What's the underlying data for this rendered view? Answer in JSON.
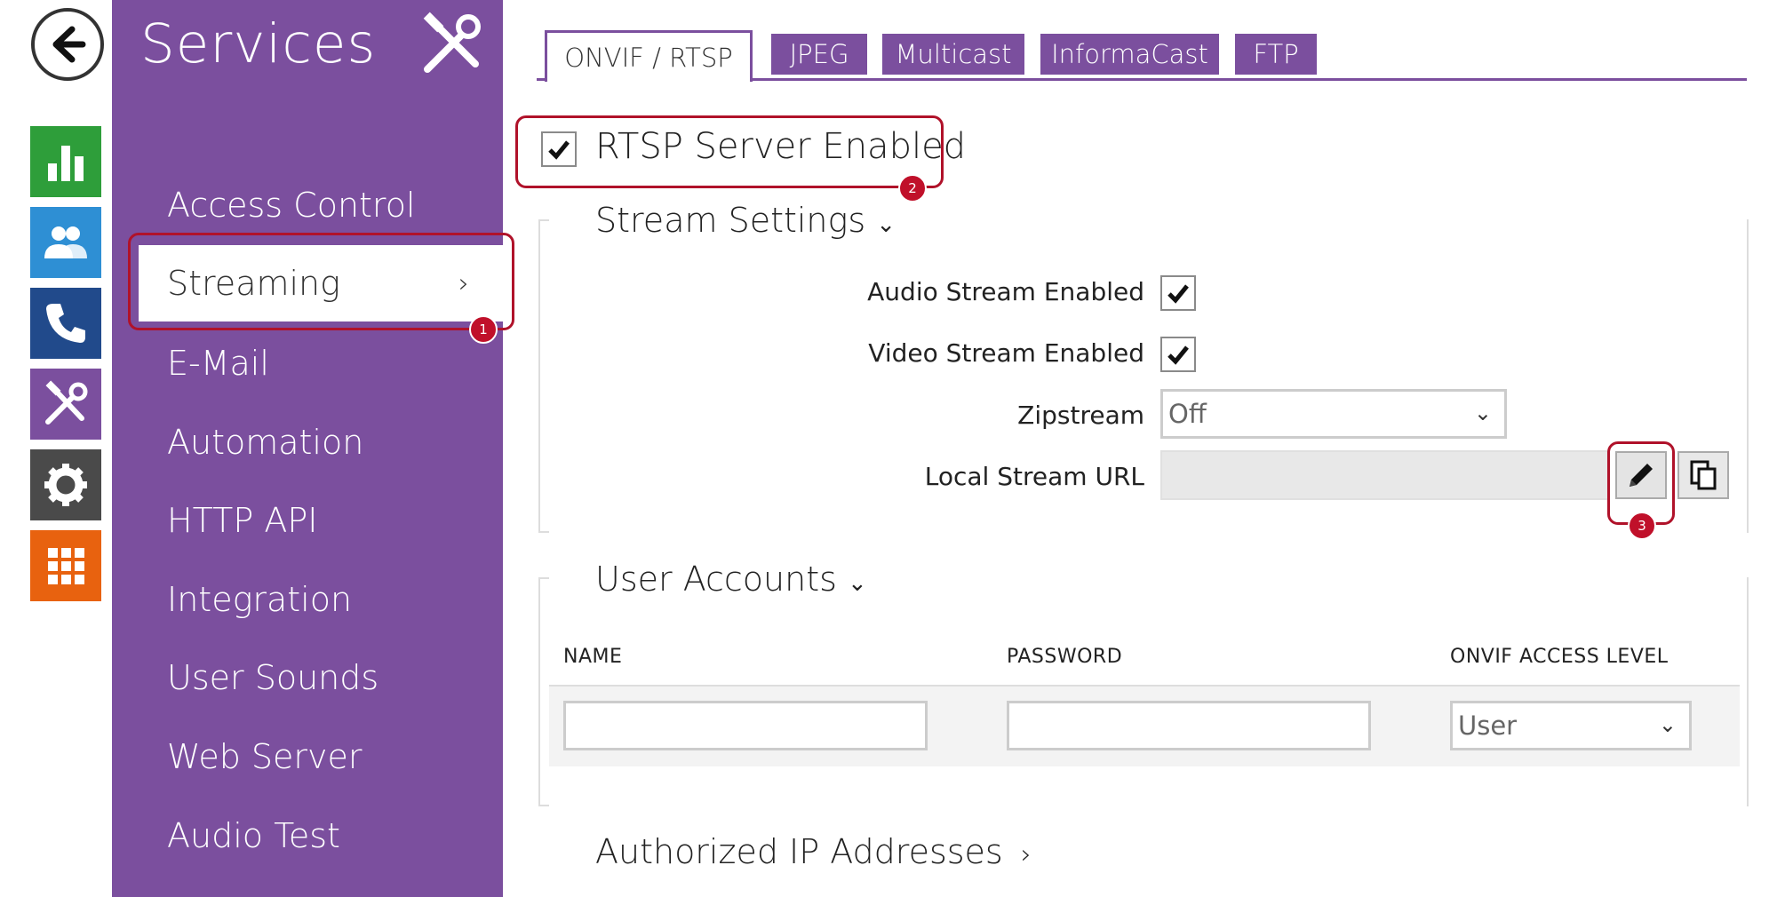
{
  "rail": {
    "icons": [
      "back-arrow-icon",
      "status-chart-icon",
      "users-icon",
      "phone-icon",
      "tools-icon",
      "gear-icon",
      "grid-icon"
    ],
    "colors": {
      "status": "#2e9e3a",
      "users": "#2e8fd4",
      "phone": "#214a8b",
      "services": "#7b4f9e",
      "settings": "#4a4a4a",
      "apps": "#e8620f"
    }
  },
  "menu": {
    "title": "Services",
    "items": [
      {
        "label": "Access Control"
      },
      {
        "label": "Streaming",
        "active": true,
        "chevron": "›"
      },
      {
        "label": "E-Mail"
      },
      {
        "label": "Automation"
      },
      {
        "label": "HTTP API"
      },
      {
        "label": "Integration"
      },
      {
        "label": "User Sounds"
      },
      {
        "label": "Web Server"
      },
      {
        "label": "Audio Test"
      }
    ],
    "color": "#7b4f9e"
  },
  "tabs": [
    "ONVIF / RTSP",
    "JPEG",
    "Multicast",
    "InformaCast",
    "FTP"
  ],
  "rtsp": {
    "label": "RTSP Server Enabled",
    "checked": true
  },
  "stream_settings": {
    "title": "Stream Settings",
    "audio_label": "Audio Stream Enabled",
    "video_label": "Video Stream Enabled",
    "zipstream_label": "Zipstream",
    "zipstream_value": "Off",
    "url_label": "Local Stream URL",
    "url_value": ""
  },
  "user_accounts": {
    "title": "User Accounts",
    "columns": [
      "NAME",
      "PASSWORD",
      "ONVIF ACCESS LEVEL"
    ],
    "access_value": "User"
  },
  "authorized_ip": {
    "title": "Authorized IP Addresses"
  },
  "badges": [
    "1",
    "2",
    "3"
  ],
  "glyphs": {
    "expand": "⌄",
    "collapse": "›",
    "caret": "⌄"
  }
}
